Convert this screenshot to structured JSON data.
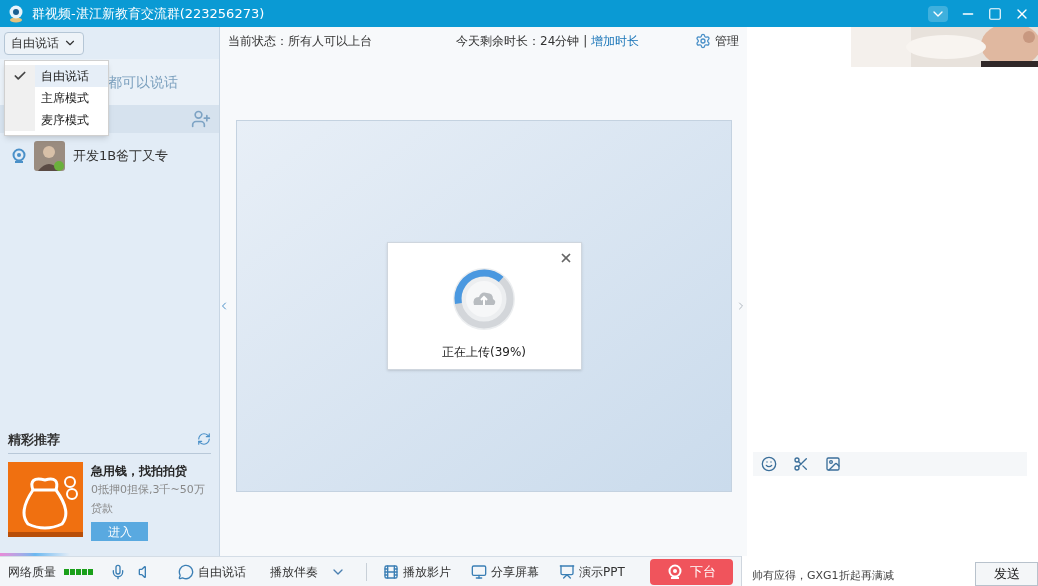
{
  "window": {
    "title": "群视频-湛江新教育交流群(223256273)"
  },
  "left_panel": {
    "mode_button": {
      "label": "自由说话"
    },
    "mode_menu": [
      {
        "label": "自由说话",
        "selected": true
      },
      {
        "label": "主席模式",
        "selected": false
      },
      {
        "label": "麦序模式",
        "selected": false
      }
    ],
    "mode_hint": "都可以说话",
    "members": [
      {
        "name": "开发1B爸丁又专"
      }
    ],
    "recommend": {
      "title": "精彩推荐",
      "ad_title": "急用钱，找拍拍贷",
      "ad_text": "0抵押0担保,3千~50万贷款",
      "button": "进入"
    }
  },
  "center": {
    "status": "当前状态：所有人可以上台",
    "remaining": "今天剩余时长：24分钟",
    "separator": "|",
    "link": "增加时长",
    "manage": "管理",
    "upload": {
      "text": "正在上传(39%)",
      "level": 0.39
    }
  },
  "toolbar": {
    "network_label": "网络质量",
    "items": [
      {
        "kind": "voice",
        "label": "自由说话"
      },
      {
        "kind": "accompany",
        "label": "播放伴奏"
      },
      {
        "kind": "movie",
        "label": "播放影片"
      },
      {
        "kind": "share",
        "label": "分享屏幕"
      },
      {
        "kind": "ppt",
        "label": "演示PPT"
      }
    ],
    "stage_button": "下台"
  },
  "chat": {
    "ad_text": "帅有应得，GXG1折起再满减",
    "send": "发送"
  }
}
